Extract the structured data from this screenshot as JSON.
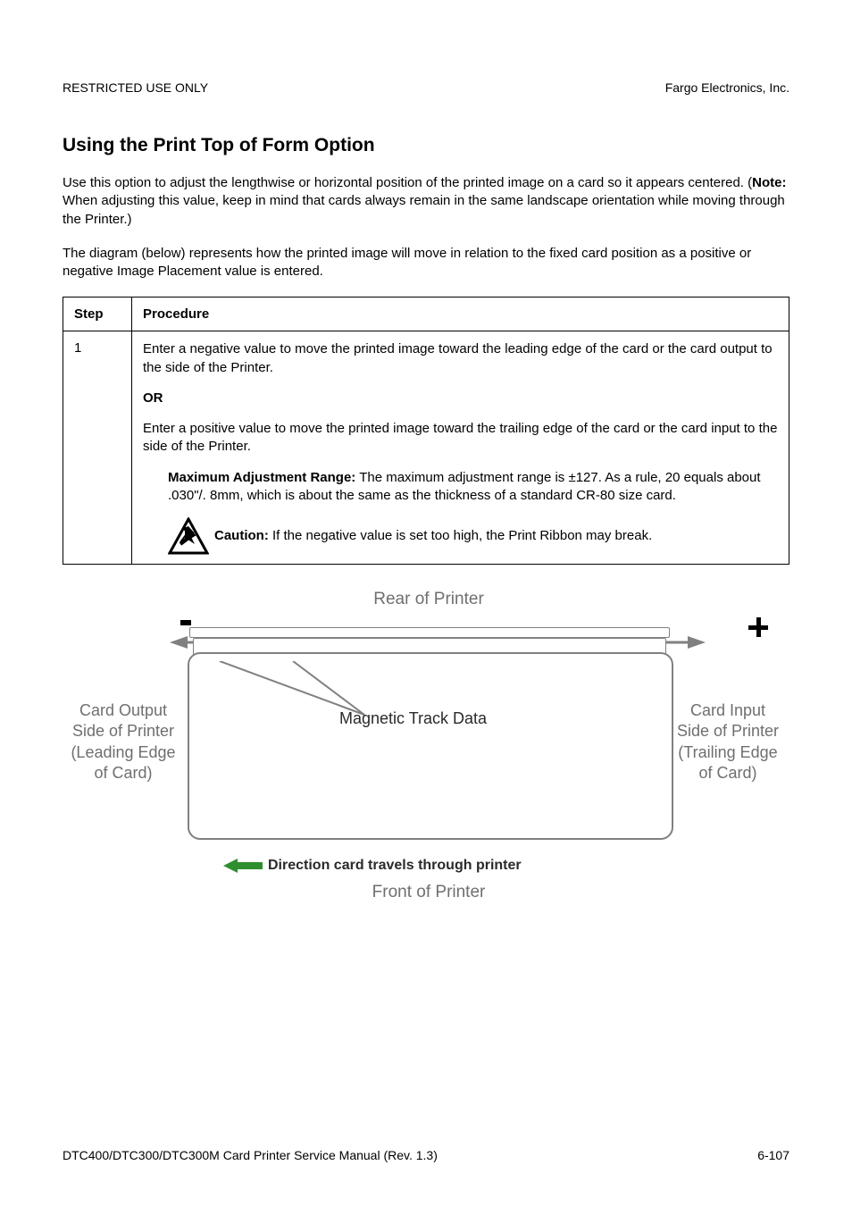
{
  "header": {
    "left": "RESTRICTED USE ONLY",
    "right": "Fargo Electronics, Inc."
  },
  "section": {
    "heading": "Using the Print Top of Form Option",
    "para1_a": "Use this option to adjust the lengthwise or horizontal position of the printed image on a card so it appears centered. (",
    "para1_note_label": "Note:",
    "para1_b": "  When adjusting this value, keep in mind that cards always remain in the same landscape orientation while moving through the Printer.)",
    "para2": "The diagram (below) represents how the printed image will move in relation to the fixed card position as a positive or negative Image Placement value is entered."
  },
  "table": {
    "header_step": "Step",
    "header_proc": "Procedure",
    "step1": "1",
    "proc": {
      "p1": "Enter a negative value to move the printed image toward the leading edge of the card or the card output to the side of the Printer.",
      "or": "OR",
      "p2": "Enter a positive value to move the printed image toward the trailing edge of the card or the card input to the side of the Printer.",
      "max_label": "Maximum Adjustment Range:",
      "max_text": "  The maximum adjustment range is ±127. As a rule, 20 equals about .030\"/. 8mm, which is about the same as the thickness of a standard CR-80 size card.",
      "caution_label": "Caution:",
      "caution_text": "  If the negative value is set too high, the Print Ribbon may break."
    }
  },
  "diagram": {
    "rear": "Rear of Printer",
    "mag": "Magnetic Track Data",
    "left1": "Card Output",
    "left2": "Side of Printer",
    "left3": "(Leading Edge",
    "left4": "of Card)",
    "right1": "Card Input",
    "right2": "Side of Printer",
    "right3": "(Trailing Edge",
    "right4": "of Card)",
    "direction": "Direction card travels through printer",
    "front": "Front of Printer"
  },
  "footer": {
    "left": "DTC400/DTC300/DTC300M Card Printer Service Manual (Rev. 1.3)",
    "right": "6-107"
  }
}
